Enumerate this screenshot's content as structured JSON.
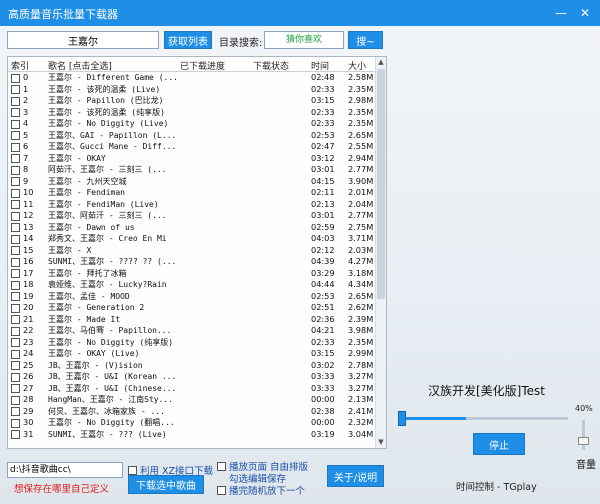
{
  "window": {
    "title": "高质量音乐批量下载器",
    "min_glyph": "—",
    "close_glyph": "✕"
  },
  "search": {
    "value": "王嘉尔",
    "fetch_label": "获取列表",
    "dir_search_label": "目录搜索:",
    "dir_search_value": "猜你喜欢",
    "search_button_label": "搜~"
  },
  "table": {
    "headers": {
      "index": "索引",
      "name": "歌名 [点击全选]",
      "progress": "已下载进度",
      "status": "下载状态",
      "duration": "时间",
      "size": "大小"
    },
    "rows": [
      {
        "index": "0",
        "name": "王嘉尔 - Different Game (...",
        "duration": "02:48",
        "size": "2.58M"
      },
      {
        "index": "1",
        "name": "王嘉尔 - 该死的温柔 (Live)",
        "duration": "02:33",
        "size": "2.35M"
      },
      {
        "index": "2",
        "name": "王嘉尔 - Papillon (巴比龙)",
        "duration": "03:15",
        "size": "2.98M"
      },
      {
        "index": "3",
        "name": "王嘉尔 - 该死的温柔 (纯享版)",
        "duration": "02:33",
        "size": "2.35M"
      },
      {
        "index": "4",
        "name": "王嘉尔 - No Diggity (Live)",
        "duration": "02:33",
        "size": "2.35M"
      },
      {
        "index": "5",
        "name": "王嘉尔、GAI - Papillon (L...",
        "duration": "02:53",
        "size": "2.65M"
      },
      {
        "index": "6",
        "name": "王嘉尔、Gucci Mane - Diff...",
        "duration": "02:47",
        "size": "2.55M"
      },
      {
        "index": "7",
        "name": "王嘉尔 - OKAY",
        "duration": "03:12",
        "size": "2.94M"
      },
      {
        "index": "8",
        "name": "阿茹汗、王嘉尔 - 三刻三 (...",
        "duration": "03:01",
        "size": "2.77M"
      },
      {
        "index": "9",
        "name": "王嘉尔 - 九州天空城",
        "duration": "04:15",
        "size": "3.90M"
      },
      {
        "index": "10",
        "name": "王嘉尔 - Fendiman",
        "duration": "02:11",
        "size": "2.01M"
      },
      {
        "index": "11",
        "name": "王嘉尔 - FendiMan (Live)",
        "duration": "02:13",
        "size": "2.04M"
      },
      {
        "index": "12",
        "name": "王嘉尔、阿茹汗 - 三刻三 (...",
        "duration": "03:01",
        "size": "2.77M"
      },
      {
        "index": "13",
        "name": "王嘉尔 - Dawn of us",
        "duration": "02:59",
        "size": "2.75M"
      },
      {
        "index": "14",
        "name": "郑秀文、王嘉尔 - Creo En Mi",
        "duration": "04:03",
        "size": "3.71M"
      },
      {
        "index": "15",
        "name": "王嘉尔 - X",
        "duration": "02:12",
        "size": "2.03M"
      },
      {
        "index": "16",
        "name": "SUNMI、王嘉尔 - ???? ?? (...",
        "duration": "04:39",
        "size": "4.27M"
      },
      {
        "index": "17",
        "name": "王嘉尔 - 拜托了冰箱",
        "duration": "03:29",
        "size": "3.18M"
      },
      {
        "index": "18",
        "name": "袁娅维、王嘉尔 - Lucky?Rain",
        "duration": "04:44",
        "size": "4.34M"
      },
      {
        "index": "19",
        "name": "王嘉尔、孟佳 - MOOD",
        "duration": "02:53",
        "size": "2.65M"
      },
      {
        "index": "20",
        "name": "王嘉尔 - Generation 2",
        "duration": "02:51",
        "size": "2.62M"
      },
      {
        "index": "21",
        "name": "王嘉尔 - Made It",
        "duration": "02:36",
        "size": "2.39M"
      },
      {
        "index": "22",
        "name": "王嘉尔、马伯骞 - Papillon...",
        "duration": "04:21",
        "size": "3.98M"
      },
      {
        "index": "23",
        "name": "王嘉尔 - No Diggity (纯享版)",
        "duration": "02:33",
        "size": "2.35M"
      },
      {
        "index": "24",
        "name": "王嘉尔 - OKAY (Live)",
        "duration": "03:15",
        "size": "2.99M"
      },
      {
        "index": "25",
        "name": "JB、王嘉尔 - (V)ision",
        "duration": "03:02",
        "size": "2.78M"
      },
      {
        "index": "26",
        "name": "JB、王嘉尔 - U&I (Korean ...",
        "duration": "03:33",
        "size": "3.27M"
      },
      {
        "index": "27",
        "name": "JB、王嘉尔 - U&I (Chinese...",
        "duration": "03:33",
        "size": "3.27M"
      },
      {
        "index": "28",
        "name": "HangMan、王嘉尔 - 江南Sty...",
        "duration": "00:00",
        "size": "2.13M"
      },
      {
        "index": "29",
        "name": "何炅、王嘉尔、冰箱家族 - ...",
        "duration": "02:38",
        "size": "2.41M"
      },
      {
        "index": "30",
        "name": "王嘉尔 - No Diggity (翻唱...",
        "duration": "00:00",
        "size": "2.32M"
      },
      {
        "index": "31",
        "name": "SUNMI、王嘉尔 - ??? (Live)",
        "duration": "03:19",
        "size": "3.04M"
      }
    ]
  },
  "bottom": {
    "path_value": "d:\\抖音歌曲cc\\",
    "hint": "想保存在哪里自己定义",
    "use_xz_label": "利用 XZ接口下载",
    "download_label": "下载选中歌曲",
    "play_page_label": "播放页面 自由排版",
    "select_edit_label": "勾选编辑保存",
    "random_label": "播完随机放下一个",
    "about_label": "关于/说明"
  },
  "player": {
    "title": "汉族开发[美化版]Test",
    "progress_text": "40%",
    "progress": 0.4,
    "stop_label": "停止",
    "volume_label": "音量",
    "volume_level": 0.3,
    "time_label": "时间控制 - TGplay"
  },
  "colors": {
    "accent": "#1f8ee6",
    "hint": "#e02020",
    "link": "#1a4fa8",
    "dir_search_text": "#1aa23a"
  }
}
